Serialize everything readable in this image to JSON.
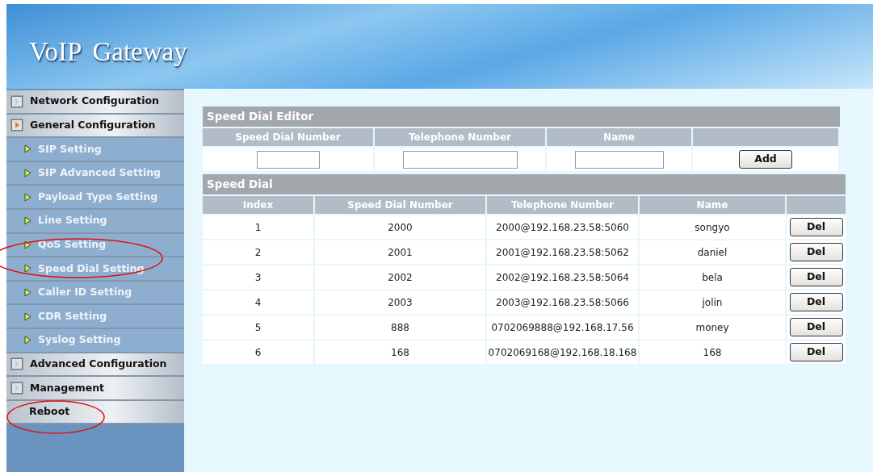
{
  "header": {
    "title": "VoIP Gateway"
  },
  "sidebar": {
    "items": [
      {
        "kind": "group",
        "label": "Network Configuration",
        "expanded": false
      },
      {
        "kind": "group",
        "label": "General Configuration",
        "expanded": true
      },
      {
        "kind": "sub",
        "label": "SIP Setting"
      },
      {
        "kind": "sub",
        "label": "SIP Advanced Setting"
      },
      {
        "kind": "sub",
        "label": "Payload Type Setting"
      },
      {
        "kind": "sub",
        "label": "Line Setting"
      },
      {
        "kind": "sub",
        "label": "QoS Setting"
      },
      {
        "kind": "sub",
        "label": "Speed Dial Setting"
      },
      {
        "kind": "sub",
        "label": "Caller ID Setting"
      },
      {
        "kind": "sub",
        "label": "CDR Setting"
      },
      {
        "kind": "sub",
        "label": "Syslog Setting"
      },
      {
        "kind": "group",
        "label": "Advanced Configuration",
        "expanded": false
      },
      {
        "kind": "group",
        "label": "Management",
        "expanded": false
      },
      {
        "kind": "plain",
        "label": "Reboot"
      }
    ]
  },
  "editor": {
    "title": "Speed Dial Editor",
    "columns": [
      "Speed Dial Number",
      "Telephone Number",
      "Name"
    ],
    "button": "Add"
  },
  "speed_dial": {
    "title": "Speed Dial",
    "columns": [
      "Index",
      "Speed Dial Number",
      "Telephone Number",
      "Name"
    ],
    "rows": [
      {
        "cells": [
          "1",
          "2000",
          "2000@192.168.23.58:5060",
          "songyo"
        ],
        "button": "Del"
      },
      {
        "cells": [
          "2",
          "2001",
          "2001@192.168.23.58:5062",
          "daniel"
        ],
        "button": "Del"
      },
      {
        "cells": [
          "3",
          "2002",
          "2002@192.168.23.58:5064",
          "bela"
        ],
        "button": "Del"
      },
      {
        "cells": [
          "4",
          "2003",
          "2003@192.168.23.58:5066",
          "jolin"
        ],
        "button": "Del"
      },
      {
        "cells": [
          "5",
          "888",
          "0702069888@192.168.17.56",
          "money"
        ],
        "button": "Del"
      },
      {
        "cells": [
          "6",
          "168",
          "0702069168@192.168.18.168",
          "168"
        ],
        "button": "Del"
      }
    ]
  }
}
